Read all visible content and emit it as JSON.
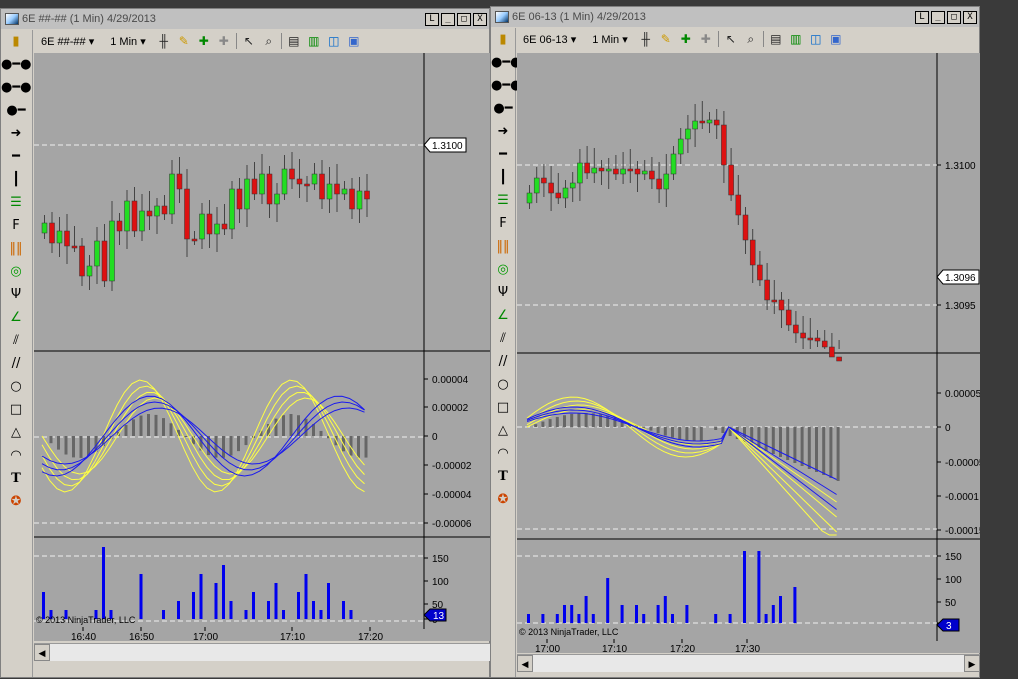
{
  "windows": [
    {
      "title": "6E ##-## (1 Min)  4/29/2013",
      "instrument": "6E ##-##",
      "interval": "1 Min",
      "price_axis": [
        "1.3100"
      ],
      "price_marker": "1.3100",
      "osc_axis": [
        "0.00004",
        "0.00002",
        "0",
        "-0.00002",
        "-0.00004",
        "-0.00006"
      ],
      "vol_axis": [
        "150",
        "100",
        "50",
        "0"
      ],
      "vol_marker": "13",
      "time_axis": [
        "16:40",
        "16:50",
        "17:00",
        "17:10",
        "17:20"
      ],
      "copyright": "© 2013 NinjaTrader, LLC"
    },
    {
      "title": "6E 06-13 (1 Min)  4/29/2013",
      "instrument": "6E 06-13",
      "interval": "1 Min",
      "price_axis": [
        "1.3100",
        "1.3095"
      ],
      "price_marker": "1.3096",
      "osc_axis": [
        "0.00005",
        "0",
        "-0.00005",
        "-0.0001",
        "-0.00015"
      ],
      "vol_axis": [
        "150",
        "100",
        "50",
        "0"
      ],
      "vol_marker": "3",
      "time_axis": [
        "17:00",
        "17:10",
        "17:20",
        "17:30"
      ],
      "copyright": "© 2013 NinjaTrader, LLC"
    }
  ],
  "window_buttons": {
    "restore": "L",
    "minimize": "_",
    "maximize": "□",
    "close": "X"
  },
  "toolbar_icons": [
    "bar-type-icon",
    "pencil-icon",
    "zoom-in-icon",
    "zoom-out-icon",
    "pointer-icon",
    "magnifier-icon",
    "data-box-icon",
    "chart-style-icon",
    "indicator-icon",
    "properties-icon"
  ],
  "left_tools": [
    "segment-icon",
    "ruler-icon",
    "ray-icon",
    "arrow-line-icon",
    "horizontal-line-icon",
    "vertical-line-icon",
    "fib-retracement-icon",
    "fib-extension-icon",
    "fib-time-icon",
    "fib-circle-icon",
    "andrews-pitchfork-icon",
    "gann-fan-icon",
    "regression-channel-icon",
    "trend-channel-icon",
    "ellipse-icon",
    "rectangle-icon",
    "triangle-icon",
    "arc-icon",
    "text-icon",
    "chart-marker-icon"
  ],
  "colors": {
    "up": "#22dd22",
    "down": "#dd1111",
    "panel": "#a5a5a5",
    "volume": "#0000ee",
    "osc_yellow": "#ffff44",
    "osc_blue": "#1a1aee",
    "histogram": "#666666"
  }
}
